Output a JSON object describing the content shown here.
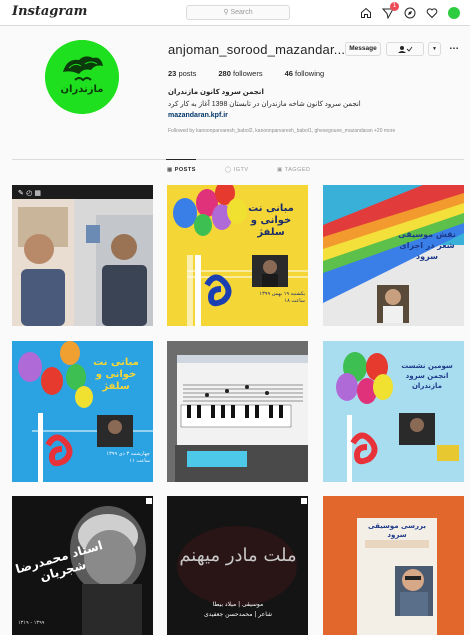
{
  "nav": {
    "logo": "Instagram",
    "search_placeholder": "Search",
    "notification_count": "1",
    "icons": [
      "home-icon",
      "direct-icon",
      "explore-icon",
      "heart-icon",
      "avatar"
    ]
  },
  "profile": {
    "username": "anjoman_sorood_mazandar...",
    "message_label": "Message",
    "posts_count": "23",
    "posts_label": "posts",
    "followers_count": "280",
    "followers_label": "followers",
    "following_count": "46",
    "following_label": "following",
    "full_name": "انجمن سرود کانون مازندران",
    "bio": "انجمن سرود کانون شاخه مازندران در تابستان 1398 آغاز به کار کرد",
    "link": "mazandaran.kpf.ir",
    "followed_by_prefix": "Followed by",
    "followed_by_names": "kanoonparvaresh_babol2, kanoonparvaresh_babol1, ghesegouee_mazandaran",
    "followed_by_more": "+20 more",
    "logo_text": "مازندران"
  },
  "tabs": {
    "posts": "POSTS",
    "igtv": "IGTV",
    "tagged": "TAGGED"
  },
  "posts": {
    "p2_title": "مبانی نت خوانی و سلفژ",
    "p2_date": "یکشنبه ۱۹ بهمن ۱۳۹۹",
    "p2_time": "ساعت ۱۸",
    "p3_title": "نقش موسیقی شعر در اجرای سرود",
    "p4_title": "مبانی نت خوانی و سلفژ",
    "p4_date": "چهارشنبه ۳ دی ۱۳۹۹",
    "p4_time": "ساعت ۱۱",
    "p6_title": "سومین نشست انجمن سرود مازندران",
    "p7_title": "استاد محمدرضا شجریان",
    "p7_years": "۱۳۱۹ - ۱۳۹۹",
    "p8_title": "ملت مادر میهنم",
    "p8_credits": "موسیقی | میلاد بیطا",
    "p8_poet": "شاعر | محمدحسن جعفیدی",
    "p9_title": "بررسی موسیقی سرود"
  },
  "colors": {
    "accent_link": "#003569",
    "profile_bg": "#1fe01f",
    "notification": "#ed4956"
  }
}
